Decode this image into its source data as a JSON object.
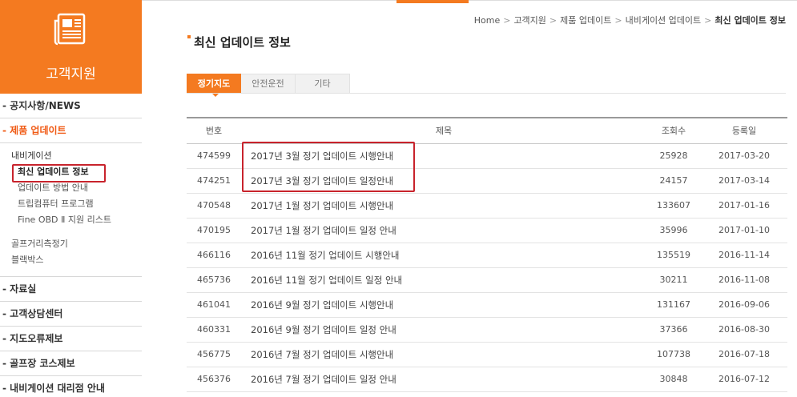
{
  "sidebar": {
    "title": "고객지원",
    "menu_top": [
      {
        "label": "- 공지사항/NEWS",
        "active": false
      },
      {
        "label": "- 제품 업데이트",
        "active": true
      }
    ],
    "submenu": {
      "heading": "내비게이션",
      "items": [
        "최신 업데이트 정보",
        "업데이트 방법 안내",
        "트립컴퓨터 프로그램",
        "Fine OBD Ⅱ 지원 리스트"
      ],
      "items2": [
        "골프거리측정기",
        "블랙박스"
      ]
    },
    "menu_bottom": [
      {
        "label": "- 자료실"
      },
      {
        "label": "- 고객상담센터"
      },
      {
        "label": "- 지도오류제보"
      },
      {
        "label": "- 골프장 코스제보"
      },
      {
        "label": "- 내비게이션 대리점 안내"
      }
    ]
  },
  "breadcrumb": {
    "home": "Home",
    "path": [
      "고객지원",
      "제품 업데이트",
      "내비게이션 업데이트"
    ],
    "current": "최신 업데이트 정보",
    "sep": ">"
  },
  "page_title": "최신 업데이트 정보",
  "tabs": [
    {
      "label": "정기지도",
      "active": true
    },
    {
      "label": "안전운전",
      "active": false
    },
    {
      "label": "기타",
      "active": false
    }
  ],
  "table": {
    "headers": {
      "no": "번호",
      "subject": "제목",
      "views": "조회수",
      "date": "등록일"
    },
    "rows": [
      {
        "no": "474599",
        "subject": "2017년 3월 정기 업데이트 시행안내",
        "views": "25928",
        "date": "2017-03-20"
      },
      {
        "no": "474251",
        "subject": "2017년 3월 정기 업데이트 일정안내",
        "views": "24157",
        "date": "2017-03-14"
      },
      {
        "no": "470548",
        "subject": "2017년 1월 정기 업데이트 시행안내",
        "views": "133607",
        "date": "2017-01-16"
      },
      {
        "no": "470195",
        "subject": "2017년 1월 정기 업데이트 일정 안내",
        "views": "35996",
        "date": "2017-01-10"
      },
      {
        "no": "466116",
        "subject": "2016년 11월 정기 업데이트 시행안내",
        "views": "135519",
        "date": "2016-11-14"
      },
      {
        "no": "465736",
        "subject": "2016년 11월 정기 업데이트 일정 안내",
        "views": "30211",
        "date": "2016-11-08"
      },
      {
        "no": "461041",
        "subject": "2016년 9월 정기 업데이트 시행안내",
        "views": "131167",
        "date": "2016-09-06"
      },
      {
        "no": "460331",
        "subject": "2016년 9월 정기 업데이트 일정 안내",
        "views": "37366",
        "date": "2016-08-30"
      },
      {
        "no": "456775",
        "subject": "2016년 7월 정기 업데이트 시행안내",
        "views": "107738",
        "date": "2016-07-18"
      },
      {
        "no": "456376",
        "subject": "2016년 7월 정기 업데이트 일정 안내",
        "views": "30848",
        "date": "2016-07-12"
      }
    ]
  },
  "colors": {
    "accent": "#f47a20",
    "highlight_box": "#c8232c"
  }
}
